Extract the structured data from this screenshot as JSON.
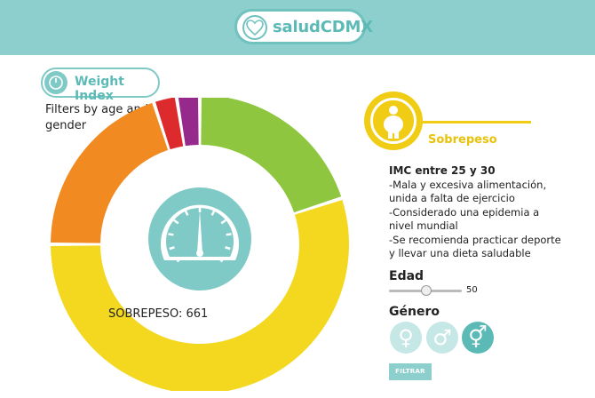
{
  "header": {
    "app_title": "saludCDMX",
    "logo_icon": "heart-icon"
  },
  "weight_index": {
    "label": "Weight Index",
    "icon": "scale-icon"
  },
  "filters_text": "Filters by age and gender",
  "chart_data": {
    "type": "pie",
    "title": "",
    "slices": [
      {
        "label": "",
        "value": 8,
        "color": "#8ec63f"
      },
      {
        "label": "",
        "value": 22,
        "color": "#f3d81f"
      },
      {
        "label": "",
        "value": 8,
        "color": "#f08a21"
      },
      {
        "label": "",
        "value": 1,
        "color": "#dd2a2c"
      },
      {
        "label": "",
        "value": 1,
        "color": "#962a8c"
      }
    ],
    "center_icon": "gauge-icon",
    "hover_label": "SOBREPESO: 661"
  },
  "category": {
    "icon": "overweight-person-icon",
    "name": "Sobrepeso",
    "title": "IMC entre 25 y 30",
    "lines": [
      "-Mala y excesiva alimentación, unida a falta de ejercicio",
      "-Considerado una epidemia a nivel mundial",
      "-Se recomienda practicar deporte y llevar una dieta saludable"
    ]
  },
  "edad": {
    "label": "Edad",
    "value": "50",
    "slider_fraction": 0.5
  },
  "genero": {
    "label": "Género",
    "options": [
      {
        "icon": "female-icon",
        "glyph": "♀"
      },
      {
        "icon": "male-icon",
        "glyph": "♂"
      },
      {
        "icon": "both-genders-icon",
        "glyph": "⚥"
      }
    ]
  },
  "filtrar_label": "FILTRAR",
  "colors": {
    "teal": "#8ccfcc",
    "yellow": "#f1cc14"
  }
}
